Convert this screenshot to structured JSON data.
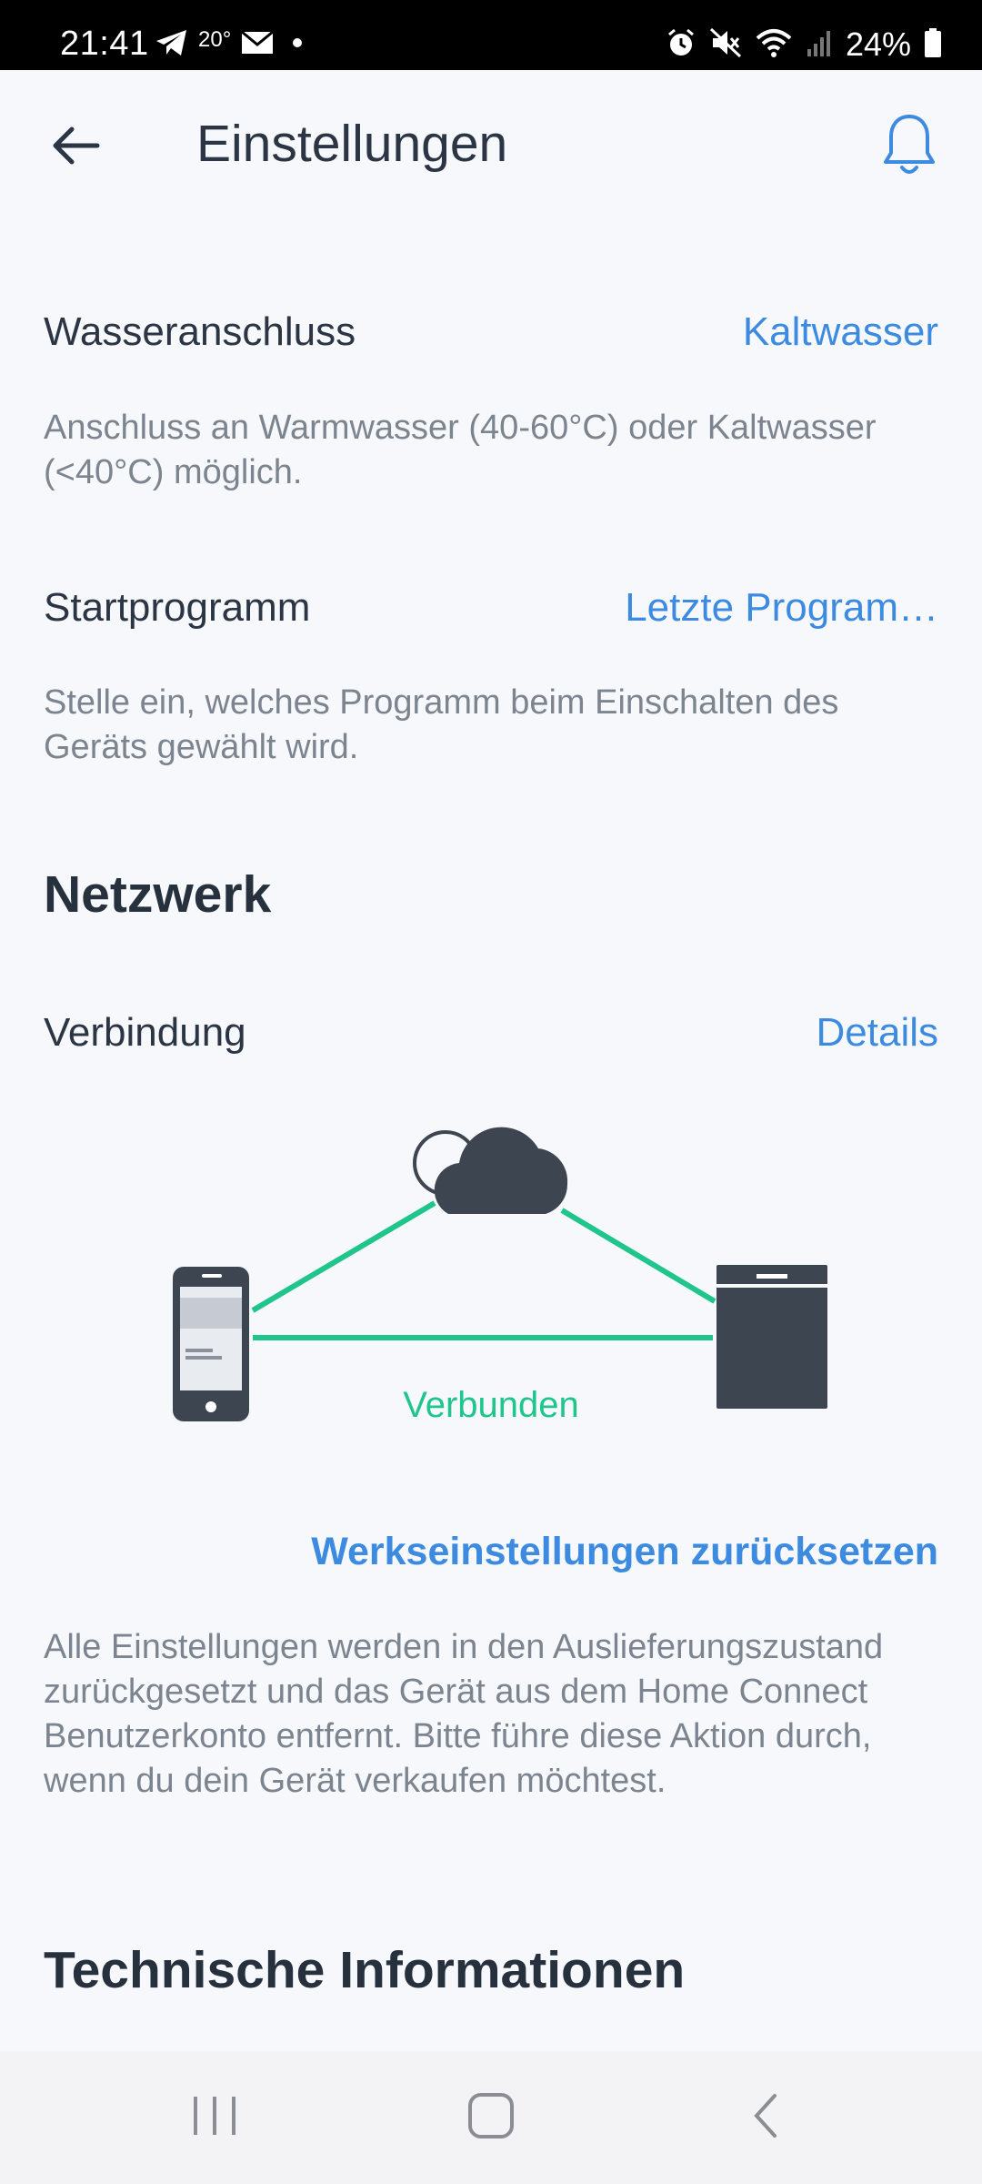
{
  "status_bar": {
    "time": "21:41",
    "temperature": "20°",
    "battery": "24%",
    "icons": [
      "telegram-icon",
      "mail-icon",
      "dot-icon",
      "alarm-icon",
      "mute-icon",
      "wifi-icon",
      "signal-icon",
      "battery-icon"
    ]
  },
  "header": {
    "title": "Einstellungen",
    "back_icon": "back-arrow-icon",
    "bell_icon": "bell-icon"
  },
  "settings": {
    "water": {
      "label": "Wasseranschluss",
      "value": "Kaltwasser",
      "description": "Anschluss an Warmwasser (40-60°C) oder Kaltwasser (<40°C) möglich."
    },
    "start_program": {
      "label": "Startprogramm",
      "value": "Letzte Program…",
      "description": "Stelle ein, welches Programm beim Einschalten des Geräts gewählt wird."
    }
  },
  "network": {
    "title": "Netzwerk",
    "connection_label": "Verbindung",
    "details_label": "Details",
    "status": "Verbunden",
    "status_color": "#1fc58a"
  },
  "reset": {
    "label": "Werkseinstellungen zurücksetzen",
    "description": "Alle Einstellungen werden in den Auslieferungszustand zurückgesetzt und das Gerät aus dem Home Connect Benutzerkonto entfernt. Bitte führe diese Aktion durch, wenn du dein Gerät verkaufen möchtest."
  },
  "technical": {
    "title": "Technische Informationen"
  },
  "colors": {
    "accent": "#3c8be0",
    "text": "#2b3543",
    "secondary_text": "#7c848f",
    "background": "#f6f8fc",
    "device": "#3d4550"
  },
  "nav_bar": {
    "recents_icon": "recents-icon",
    "home_icon": "home-icon",
    "back_icon": "nav-back-icon"
  }
}
